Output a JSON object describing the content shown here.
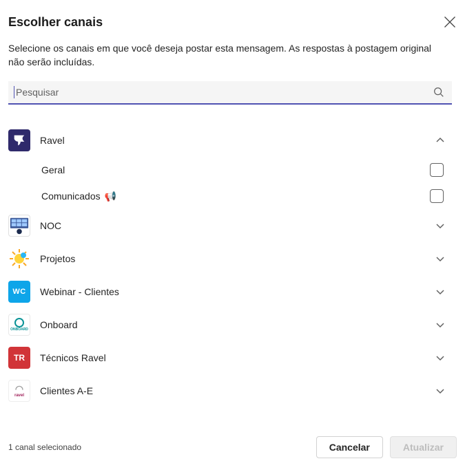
{
  "header": {
    "title": "Escolher canais",
    "subtitle": "Selecione os canais em que você deseja postar esta mensagem. As respostas à postagem original não serão incluídas."
  },
  "search": {
    "placeholder": "Pesquisar",
    "value": ""
  },
  "teams": [
    {
      "name": "Ravel",
      "expanded": true,
      "avatar": "ravel",
      "channels": [
        {
          "name": "Geral",
          "icon": null,
          "checked": false
        },
        {
          "name": "Comunicados",
          "icon": "📢",
          "checked": false
        }
      ]
    },
    {
      "name": "NOC",
      "expanded": false,
      "avatar": "noc"
    },
    {
      "name": "Projetos",
      "expanded": false,
      "avatar": "projetos"
    },
    {
      "name": "Webinar - Clientes",
      "expanded": false,
      "avatar": "wc",
      "initials": "WC"
    },
    {
      "name": "Onboard",
      "expanded": false,
      "avatar": "onboard"
    },
    {
      "name": "Técnicos Ravel",
      "expanded": false,
      "avatar": "tr",
      "initials": "TR"
    },
    {
      "name": "Clientes A-E",
      "expanded": false,
      "avatar": "clientes"
    }
  ],
  "footer": {
    "status": "1 canal selecionado",
    "cancel": "Cancelar",
    "update": "Atualizar"
  }
}
